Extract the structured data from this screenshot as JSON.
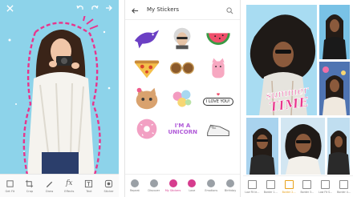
{
  "editor": {
    "tools": [
      {
        "label": "Get Fit",
        "icon": "crop-icon"
      },
      {
        "label": "Crop",
        "icon": "crop-icon"
      },
      {
        "label": "Draw",
        "icon": "brush-icon"
      },
      {
        "label": "Effects",
        "icon": "fx-icon"
      },
      {
        "label": "Text",
        "icon": "text-icon"
      },
      {
        "label": "Sticker",
        "icon": "sticker-icon"
      }
    ],
    "effects_glyph": "fx"
  },
  "stickers": {
    "title": "My Stickers",
    "speech_bubble_text": "I LOVE YOU!",
    "unicorn_text": "I'M A UNICORN",
    "categories": [
      {
        "label": "Repeat",
        "color": "#9aa0a6"
      },
      {
        "label": "Discover",
        "color": "#9aa0a6"
      },
      {
        "label": "My Stickers",
        "color": "#d63c8e"
      },
      {
        "label": "Love",
        "color": "#d63c8e"
      },
      {
        "label": "Emotions",
        "color": "#9aa0a6"
      },
      {
        "label": "Birthday",
        "color": "#9aa0a6"
      }
    ],
    "active_category": "My Stickers"
  },
  "collage": {
    "overlay_text_line1": "summer",
    "overlay_text_line2": "TIME",
    "layouts": [
      {
        "label": "Low Fit le…"
      },
      {
        "label": "Border 1…"
      },
      {
        "label": "Border 2…"
      },
      {
        "label": "Border 3…"
      },
      {
        "label": "Low Fit S…"
      },
      {
        "label": "Border 4…"
      }
    ],
    "active_layout": "Border 2…"
  },
  "colors": {
    "editor_bg": "#8dd3ea",
    "accent_pink": "#d63c8e",
    "accent_orange": "#e8a21b",
    "dashed_outline": "#e8358c"
  }
}
